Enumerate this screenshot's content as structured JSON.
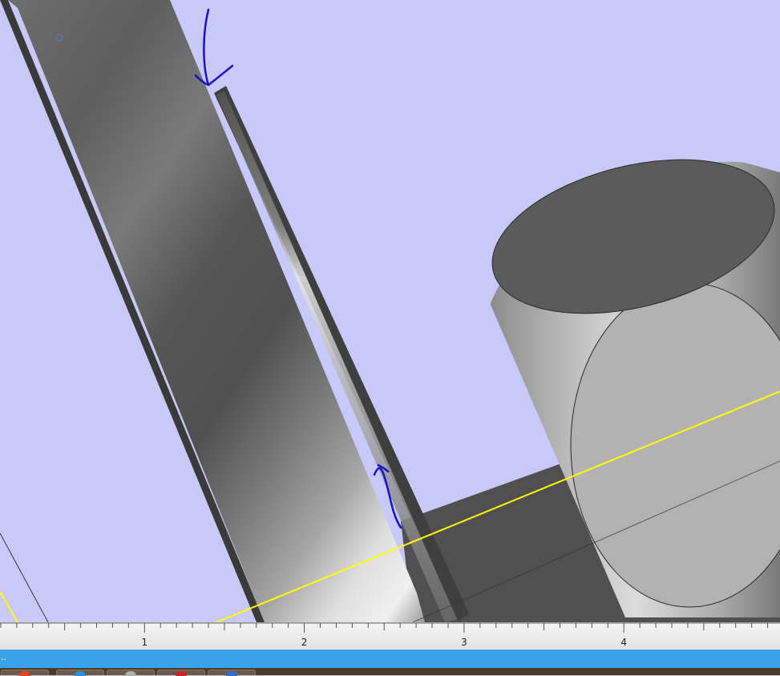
{
  "ruler": {
    "ticks": [
      "1",
      "2",
      "3",
      "4"
    ]
  },
  "status": {
    "text": ".."
  },
  "colors": {
    "background": "#c9c8fb",
    "axis_line": "#ffff00",
    "annotation_ink": "#1a10c8",
    "statusbar": "#3aa3e8"
  },
  "taskbar": {
    "buttons": [
      "app-orange-icon",
      "app-blue-icon",
      "app-gray-icon",
      "app-red-icon",
      "app-blue-arrow-icon"
    ]
  }
}
